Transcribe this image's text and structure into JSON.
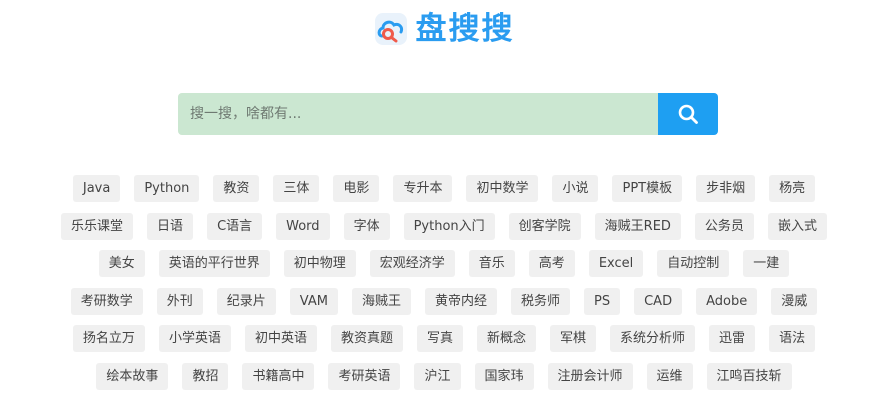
{
  "brand": {
    "name": "盘搜搜",
    "logo_icon": "cloud-search-logo-icon",
    "color": "#2a9cf0"
  },
  "search": {
    "placeholder": "搜一搜，啥都有...",
    "value": "",
    "button_icon": "search-icon",
    "input_bg": "#cbe7d1",
    "button_bg": "#1e9ff2"
  },
  "tags": [
    [
      "Java",
      "Python",
      "教资",
      "三体",
      "电影",
      "专升本",
      "初中数学",
      "小说",
      "PPT模板",
      "步非烟",
      "杨亮"
    ],
    [
      "乐乐课堂",
      "日语",
      "C语言",
      "Word",
      "字体",
      "Python入门",
      "创客学院",
      "海贼王RED",
      "公务员",
      "嵌入式"
    ],
    [
      "美女",
      "英语的平行世界",
      "初中物理",
      "宏观经济学",
      "音乐",
      "高考",
      "Excel",
      "自动控制",
      "一建"
    ],
    [
      "考研数学",
      "外刊",
      "纪录片",
      "VAM",
      "海贼王",
      "黄帝内经",
      "税务师",
      "PS",
      "CAD",
      "Adobe",
      "漫威"
    ],
    [
      "扬名立万",
      "小学英语",
      "初中英语",
      "教资真题",
      "写真",
      "新概念",
      "军棋",
      "系统分析师",
      "迅雷",
      "语法"
    ],
    [
      "绘本故事",
      "教招",
      "书籍高中",
      "考研英语",
      "沪江",
      "国家玮",
      "注册会计师",
      "运维",
      "江鸣百技斩"
    ]
  ]
}
